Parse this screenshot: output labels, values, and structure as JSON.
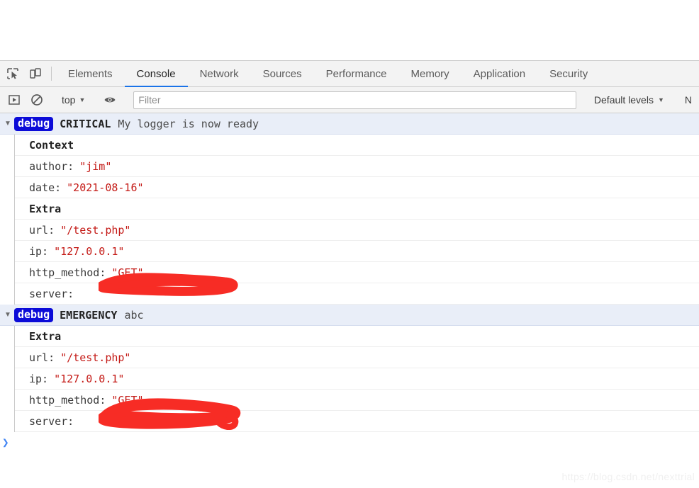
{
  "devtools": {
    "tabs": [
      {
        "label": "Elements",
        "active": false
      },
      {
        "label": "Console",
        "active": true
      },
      {
        "label": "Network",
        "active": false
      },
      {
        "label": "Sources",
        "active": false
      },
      {
        "label": "Performance",
        "active": false
      },
      {
        "label": "Memory",
        "active": false
      },
      {
        "label": "Application",
        "active": false
      },
      {
        "label": "Security",
        "active": false
      }
    ],
    "icons": {
      "inspect": "inspect-element-icon",
      "device": "device-toolbar-icon",
      "execute": "execute-snippet-icon",
      "clear": "clear-console-icon",
      "eye": "live-expression-icon"
    },
    "toolbar": {
      "context_label": "top",
      "context_caret": "▼",
      "filter_placeholder": "Filter",
      "filter_value": "",
      "levels_label": "Default levels",
      "levels_caret": "▼",
      "issues_label": "N"
    },
    "accent_color": "#1a73e8",
    "badge_color": "#0b0bd8",
    "string_color": "#c41a16",
    "redact_color": "#f72c25"
  },
  "console": {
    "twisty_glyph": "▼",
    "entries": [
      {
        "badge": "debug",
        "level": "CRITICAL",
        "message": "My logger is now ready",
        "sections": [
          {
            "title": "Context",
            "rows": [
              {
                "key": "author:",
                "value": "\"jim\"",
                "redacted": false
              },
              {
                "key": "date:",
                "value": "\"2021-08-16\"",
                "redacted": false
              }
            ]
          },
          {
            "title": "Extra",
            "rows": [
              {
                "key": "url:",
                "value": "\"/test.php\"",
                "redacted": false
              },
              {
                "key": "ip:",
                "value": "\"127.0.0.1\"",
                "redacted": false
              },
              {
                "key": "http_method:",
                "value": "\"GET\"",
                "redacted": false
              },
              {
                "key": "server:",
                "value": "\"",
                "redacted": true
              }
            ]
          }
        ]
      },
      {
        "badge": "debug",
        "level": "EMERGENCY",
        "message": "abc",
        "sections": [
          {
            "title": "Extra",
            "rows": [
              {
                "key": "url:",
                "value": "\"/test.php\"",
                "redacted": false
              },
              {
                "key": "ip:",
                "value": "\"127.0.0.1\"",
                "redacted": false
              },
              {
                "key": "http_method:",
                "value": "\"GET\"",
                "redacted": false
              },
              {
                "key": "server:",
                "value": "\"",
                "redacted": true
              }
            ]
          }
        ]
      }
    ],
    "prompt_glyph": "❯"
  },
  "watermark": {
    "text": "https://blog.csdn.net/nexttrial"
  }
}
